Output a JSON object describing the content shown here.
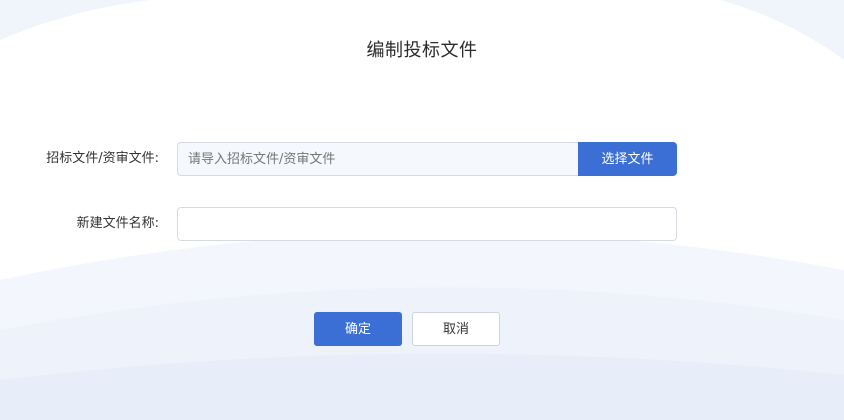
{
  "dialog": {
    "title": "编制投标文件"
  },
  "form": {
    "source_file": {
      "label": "招标文件/资审文件:",
      "placeholder": "请导入招标文件/资审文件",
      "value": "",
      "choose_button_label": "选择文件"
    },
    "new_file_name": {
      "label": "新建文件名称:",
      "value": "",
      "placeholder": ""
    }
  },
  "actions": {
    "confirm_label": "确定",
    "cancel_label": "取消"
  },
  "colors": {
    "primary": "#3b6fd6",
    "background_swoosh": "#eaf0fb"
  }
}
